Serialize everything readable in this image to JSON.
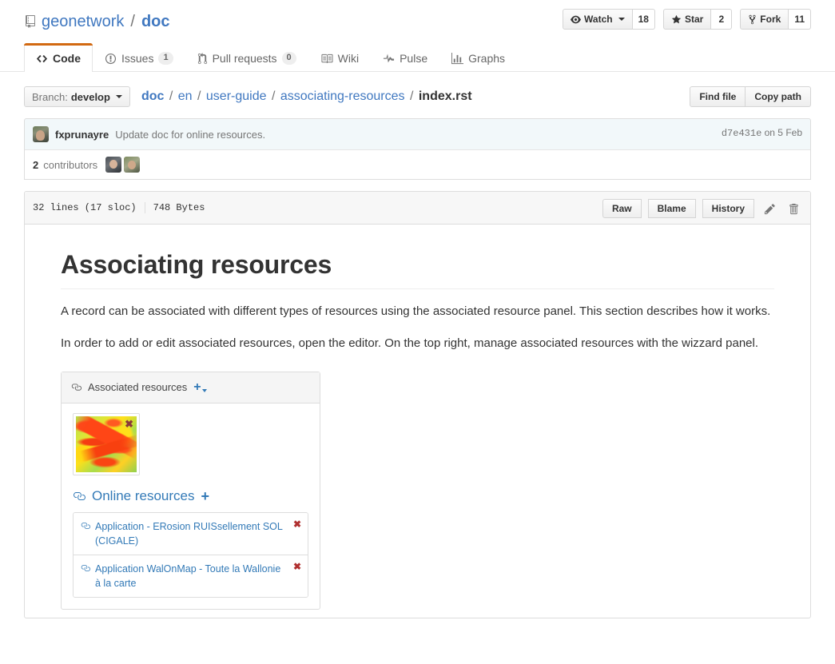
{
  "repo": {
    "owner": "geonetwork",
    "name": "doc",
    "separator": "/"
  },
  "social": {
    "watch_label": "Watch",
    "watch_count": "18",
    "star_label": "Star",
    "star_count": "2",
    "fork_label": "Fork",
    "fork_count": "11"
  },
  "nav_tabs": [
    {
      "label": "Code",
      "icon": "code-icon",
      "count": null,
      "selected": true
    },
    {
      "label": "Issues",
      "icon": "issue-opened-icon",
      "count": "1",
      "selected": false
    },
    {
      "label": "Pull requests",
      "icon": "git-pull-request-icon",
      "count": "0",
      "selected": false
    },
    {
      "label": "Wiki",
      "icon": "book-icon",
      "count": null,
      "selected": false
    },
    {
      "label": "Pulse",
      "icon": "pulse-icon",
      "count": null,
      "selected": false
    },
    {
      "label": "Graphs",
      "icon": "graph-icon",
      "count": null,
      "selected": false
    }
  ],
  "file_nav": {
    "branch_prefix": "Branch:",
    "branch_name": "develop",
    "breadcrumb": [
      {
        "label": "doc",
        "link": true
      },
      {
        "label": "en",
        "link": true
      },
      {
        "label": "user-guide",
        "link": true
      },
      {
        "label": "associating-resources",
        "link": true
      },
      {
        "label": "index.rst",
        "link": false
      }
    ],
    "find_file_label": "Find file",
    "copy_path_label": "Copy path"
  },
  "commit": {
    "author": "fxprunayre",
    "message": "Update doc for online resources.",
    "sha": "d7e431e",
    "date": "on 5 Feb",
    "contributors_count": "2",
    "contributors_label": "contributors"
  },
  "file": {
    "lines": "32 lines (17 sloc)",
    "size": "748 Bytes",
    "raw_label": "Raw",
    "blame_label": "Blame",
    "history_label": "History",
    "edit_icon": "pencil-icon",
    "delete_icon": "trashcan-icon"
  },
  "content": {
    "heading": "Associating resources",
    "paragraph_1": "A record can be associated with different types of resources using the associated resource panel. This section describes how it works.",
    "paragraph_2": "In order to add or edit associated resources, open the editor. On the top right, manage associated resources with the wizzard panel."
  },
  "embedded_screenshot": {
    "panel_title": "Associated resources",
    "add_button": "+",
    "thumbnail_remove": "✖",
    "online_resources_title": "Online resources",
    "online_resources_add": "+",
    "resources": [
      {
        "label": "Application - ERosion RUISsellement SOL (CIGALE)",
        "remove": "✖"
      },
      {
        "label": "Application WalOnMap - Toute la Wallonie à la carte",
        "remove": "✖"
      }
    ]
  },
  "colors": {
    "link": "#4078c0",
    "active_tab_border": "#d26911",
    "commit_bg": "#f2f8fa",
    "widget_link": "#337ab7",
    "remove_x": "#b03030"
  }
}
